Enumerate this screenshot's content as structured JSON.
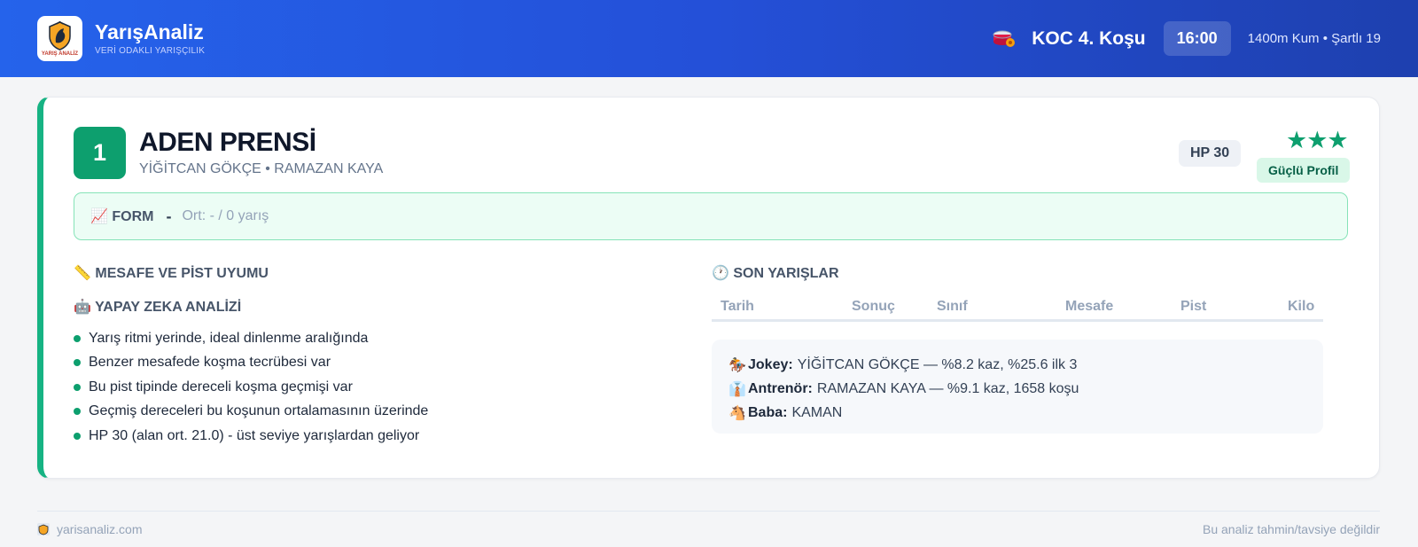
{
  "header": {
    "brand_name": "YarışAnaliz",
    "brand_tagline": "VERİ ODAKLI YARIŞÇILIK",
    "logo_text": "YARIŞ ANALİZ",
    "race_name": "KOC 4. Koşu",
    "race_time": "16:00",
    "race_meta": "1400m Kum • Şartlı 19",
    "race_icon": "racetrack-icon"
  },
  "horse": {
    "number": "1",
    "name": "ADEN PRENSİ",
    "people": "YİĞİTCAN GÖKÇE • RAMAZAN KAYA",
    "hp": "HP 30",
    "stars": "★★★",
    "rating": 3,
    "profile_label": "Güçlü Profil"
  },
  "form": {
    "icon": "📈",
    "label": "FORM",
    "value": "-",
    "average": "Ort: - / 0 yarış"
  },
  "distance_section": {
    "icon": "📏",
    "title": "MESAFE VE PİST UYUMU"
  },
  "ai_section": {
    "icon": "🤖",
    "title": "YAPAY ZEKA ANALİZİ",
    "items": [
      "Yarış ritmi yerinde, ideal dinlenme aralığında",
      "Benzer mesafede koşma tecrübesi var",
      "Bu pist tipinde dereceli koşma geçmişi var",
      "Geçmiş dereceleri bu koşunun ortalamasının üzerinde",
      "HP 30 (alan ort. 21.0) - üst seviye yarışlardan geliyor"
    ]
  },
  "recent_races": {
    "icon": "🕐",
    "title": "SON YARIŞLAR",
    "columns": [
      "Tarih",
      "Sonuç",
      "Sınıf",
      "Mesafe",
      "Pist",
      "Kilo"
    ]
  },
  "info": {
    "jockey_icon": "🏇",
    "jockey_label": "Jokey:",
    "jockey_value": "YİĞİTCAN GÖKÇE — %8.2 kaz, %25.6 ilk 3",
    "trainer_icon": "👔",
    "trainer_label": "Antrenör:",
    "trainer_value": "RAMAZAN KAYA — %9.1 kaz, 1658 koşu",
    "sire_icon": "🐴",
    "sire_label": "Baba:",
    "sire_value": "KAMAN"
  },
  "footer": {
    "site": "yarisanaliz.com",
    "disclaimer": "Bu analiz tahmin/tavsiye değildir"
  },
  "colors": {
    "header_blue": "#2563eb",
    "accent_green": "#0d9f6e",
    "form_bg": "#ecfdf5"
  }
}
